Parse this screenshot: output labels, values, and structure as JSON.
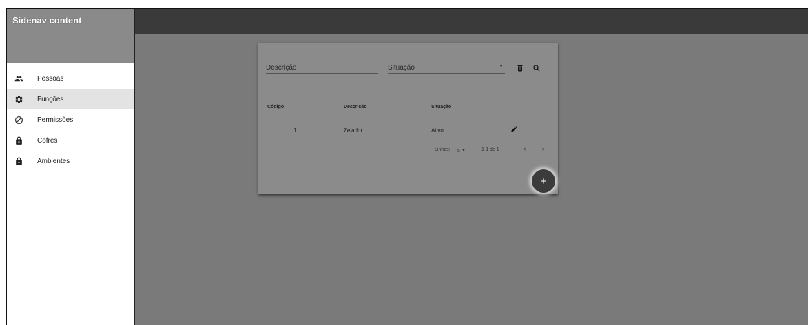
{
  "sidenav": {
    "title": "Sidenav content",
    "items": [
      {
        "label": "Pessoas",
        "icon": "people-icon"
      },
      {
        "label": "Funções",
        "icon": "gear-icon",
        "active": true
      },
      {
        "label": "Permissões",
        "icon": "block-icon"
      },
      {
        "label": "Cofres",
        "icon": "lock-icon"
      },
      {
        "label": "Ambientes",
        "icon": "lock-icon"
      }
    ]
  },
  "filters": {
    "descricao_placeholder": "Descrição",
    "situacao_placeholder": "Situação"
  },
  "table": {
    "headers": [
      "Código",
      "Descrição",
      "Situação"
    ],
    "rows": [
      {
        "codigo": "1",
        "descricao": "Zelador",
        "situacao": "Ativo"
      }
    ]
  },
  "paginator": {
    "label": "Linhas:",
    "page_size": "5",
    "range": "1-1 de 1",
    "prev": "<",
    "next": ">"
  },
  "fab_label": "+"
}
